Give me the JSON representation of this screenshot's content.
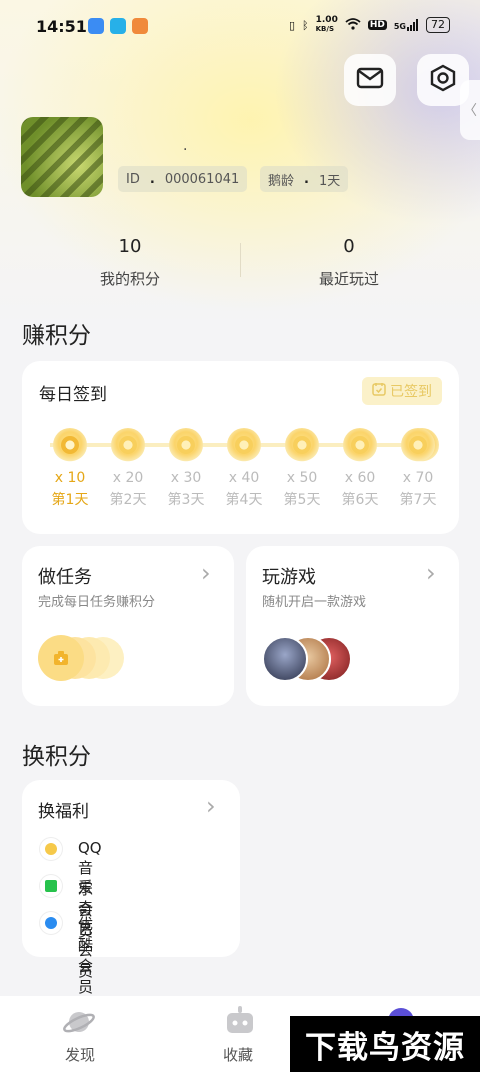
{
  "status_bar": {
    "time": "14:51",
    "network_speed_top": "1.00",
    "network_speed_unit": "KB/S",
    "hd": "HD",
    "signal": "5G",
    "battery": "72"
  },
  "profile": {
    "nickname": ".",
    "id_label": "ID",
    "id_sep": ".",
    "id_value": "000061041",
    "age_label": "鹅龄",
    "age_sep": ".",
    "age_value": "1天"
  },
  "stats": {
    "points_value": "10",
    "points_label": "我的积分",
    "recent_value": "0",
    "recent_label": "最近玩过"
  },
  "earn": {
    "title": "赚积分",
    "checkin": {
      "title": "每日签到",
      "signed_label": "已签到",
      "days": [
        {
          "mult": "x 10",
          "label": "第1天",
          "active": true
        },
        {
          "mult": "x 20",
          "label": "第2天",
          "active": false
        },
        {
          "mult": "x 30",
          "label": "第3天",
          "active": false
        },
        {
          "mult": "x 40",
          "label": "第4天",
          "active": false
        },
        {
          "mult": "x 50",
          "label": "第5天",
          "active": false
        },
        {
          "mult": "x 60",
          "label": "第6天",
          "active": false
        },
        {
          "mult": "x 70",
          "label": "第7天",
          "active": false
        }
      ]
    },
    "tasks": {
      "title": "做任务",
      "subtitle": "完成每日任务赚积分"
    },
    "games": {
      "title": "玩游戏",
      "subtitle": "随机开启一款游戏"
    }
  },
  "exchange": {
    "title": "换积分",
    "welfare": {
      "title": "换福利",
      "items": [
        {
          "label": "QQ音乐会员",
          "icon": "qq-music-icon",
          "color": "#f6c94a"
        },
        {
          "label": "爱奇艺会员",
          "icon": "iqiyi-icon",
          "color": "#27c24c"
        },
        {
          "label": "优酷会员",
          "icon": "youku-icon",
          "color": "#2a8cf0"
        }
      ]
    }
  },
  "tabbar": {
    "discover": "发现",
    "favorites": "收藏"
  },
  "watermark": "下载鸟资源",
  "colors": {
    "accent_gold": "#e5a717",
    "signed_bg": "#fbf1c9"
  }
}
